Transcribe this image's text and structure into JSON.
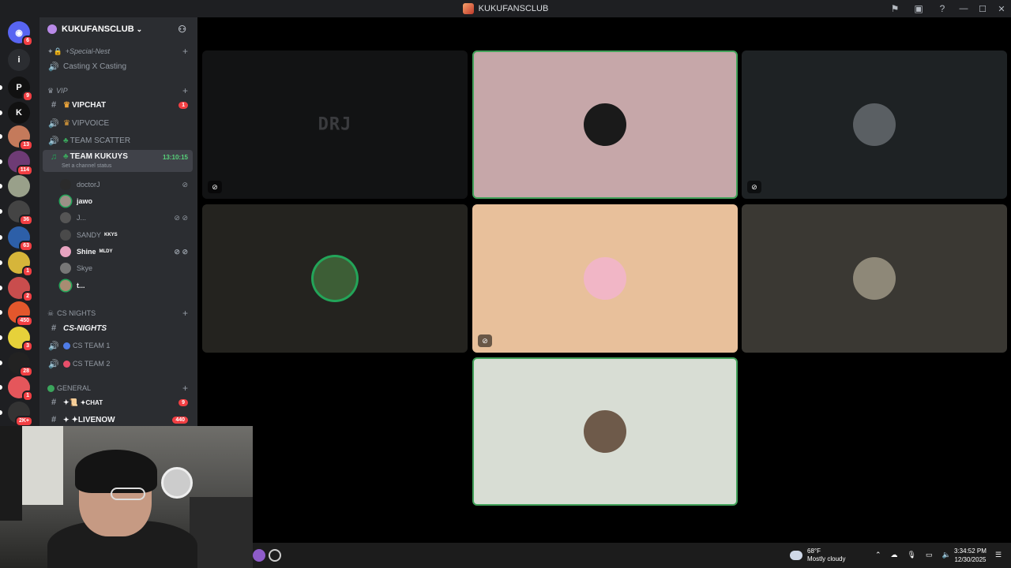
{
  "window": {
    "title": "KUKUFANSCLUB",
    "icons": [
      "inbox-flag-icon",
      "monitor-icon",
      "help-icon"
    ],
    "help_glyph": "?",
    "min": "—",
    "max": "☐",
    "close": "✕"
  },
  "guilds": [
    {
      "name": "discord-home",
      "color": "#5865f2",
      "badge": "6",
      "glyph": "◉"
    },
    {
      "name": "info",
      "color": "#2b2d31",
      "badge": "",
      "glyph": "i"
    },
    {
      "name": "server-plp",
      "color": "#111",
      "badge": "9",
      "glyph": "P"
    },
    {
      "name": "server-kick",
      "color": "#111",
      "badge": "",
      "glyph": "K"
    },
    {
      "name": "server-3",
      "color": "#c47a5b",
      "badge": "13",
      "glyph": ""
    },
    {
      "name": "server-4",
      "color": "#6e3b75",
      "badge": "114",
      "glyph": ""
    },
    {
      "name": "server-5",
      "color": "#99a08a",
      "badge": "",
      "glyph": ""
    },
    {
      "name": "server-6",
      "color": "#444",
      "badge": "36",
      "glyph": ""
    },
    {
      "name": "server-7",
      "color": "#2d5fa8",
      "badge": "63",
      "glyph": ""
    },
    {
      "name": "server-8",
      "color": "#d6b53a",
      "badge": "1",
      "glyph": ""
    },
    {
      "name": "server-9",
      "color": "#c94d4d",
      "badge": "2",
      "glyph": ""
    },
    {
      "name": "server-10",
      "color": "#e3572c",
      "badge": "450",
      "glyph": ""
    },
    {
      "name": "server-11",
      "color": "#e6d13a",
      "badge": "3",
      "glyph": ""
    },
    {
      "name": "server-12",
      "color": "#222",
      "badge": "28",
      "glyph": ""
    },
    {
      "name": "server-13",
      "color": "#e5565b",
      "badge": "1",
      "glyph": ""
    },
    {
      "name": "server-14",
      "color": "#333",
      "badge": "2K+",
      "glyph": ""
    }
  ],
  "server": {
    "name": "KUKUFANSCLUB",
    "chevron": "⌄",
    "invite_glyph": "⚇"
  },
  "categories": {
    "special": "+Special-Nest",
    "vip": "VIP",
    "cs_nights": "CS NIGHTS",
    "general": "GENERAL",
    "plus": "+"
  },
  "channels": {
    "casting": "Casting X Casting",
    "vipchat": "VIPCHAT",
    "vipchat_badge": "1",
    "vipvoice": "VIPVOICE",
    "team_scatter": "TEAM SCATTER",
    "team_kukuys": "TEAM KUKUYS",
    "team_kukuys_time": "13:10:15",
    "team_kukuys_status": "Set a channel status",
    "cs_nights_text": "CS-NIGHTS",
    "cs_team_1": "CS TEAM 1",
    "cs_team_2": "CS TEAM 2",
    "chat": "✦CHAT",
    "chat_badge": "9",
    "livenow": "✦LIVENOW",
    "livenow_badge": "440"
  },
  "members": [
    {
      "name": "doctorJ",
      "tag": "",
      "icons": "⊘",
      "color": "#2b2b2b"
    },
    {
      "name": "jawo",
      "tag": "",
      "icons": "",
      "color": "#9b8f86"
    },
    {
      "name": "J...",
      "tag": "",
      "icons": "⊘ ⊘",
      "color": "#555"
    },
    {
      "name": "SANDY",
      "tag": "KKYS",
      "icons": "",
      "color": "#4a4a4a"
    },
    {
      "name": "Shine",
      "tag": "MLDY",
      "icons": "⊘ ⊘",
      "color": "#e7a3c0"
    },
    {
      "name": "Skye",
      "tag": "",
      "icons": "",
      "color": "#777"
    },
    {
      "name": "t...",
      "tag": "",
      "icons": "",
      "color": "#a88c72"
    }
  ],
  "tiles": [
    {
      "logo": "DRJ",
      "bg": "#121314",
      "avatar": "",
      "muted": true,
      "speaking": false
    },
    {
      "logo": "",
      "bg": "#c6a7a9",
      "avatar": "#1a1a1a",
      "muted": false,
      "speaking": true
    },
    {
      "logo": "",
      "bg": "#1e2224",
      "avatar": "#5a5f63",
      "muted": true,
      "speaking": false
    },
    {
      "logo": "",
      "bg": "#24231f",
      "avatar": "#3d5e36",
      "muted": false,
      "speaking": false
    },
    {
      "logo": "",
      "bg": "#e8c09b",
      "avatar": "#f1b6c6",
      "muted": true,
      "speaking": false
    },
    {
      "logo": "",
      "bg": "#3a3833",
      "avatar": "#8e8878",
      "muted": false,
      "speaking": false
    },
    {
      "logo": "",
      "bg": "#d8ddd4",
      "avatar": "#6e5a4a",
      "muted": false,
      "speaking": true
    }
  ],
  "taskbar": {
    "weather_temp": "68°F",
    "weather_desc": "Mostly cloudy",
    "time": "3:34:52 PM",
    "date": "12/30/2025"
  },
  "colors": {
    "accent_green": "#23a559",
    "badge_red": "#f23f43",
    "sidebar": "#2b2d31",
    "guild_bar": "#1e1f22"
  }
}
